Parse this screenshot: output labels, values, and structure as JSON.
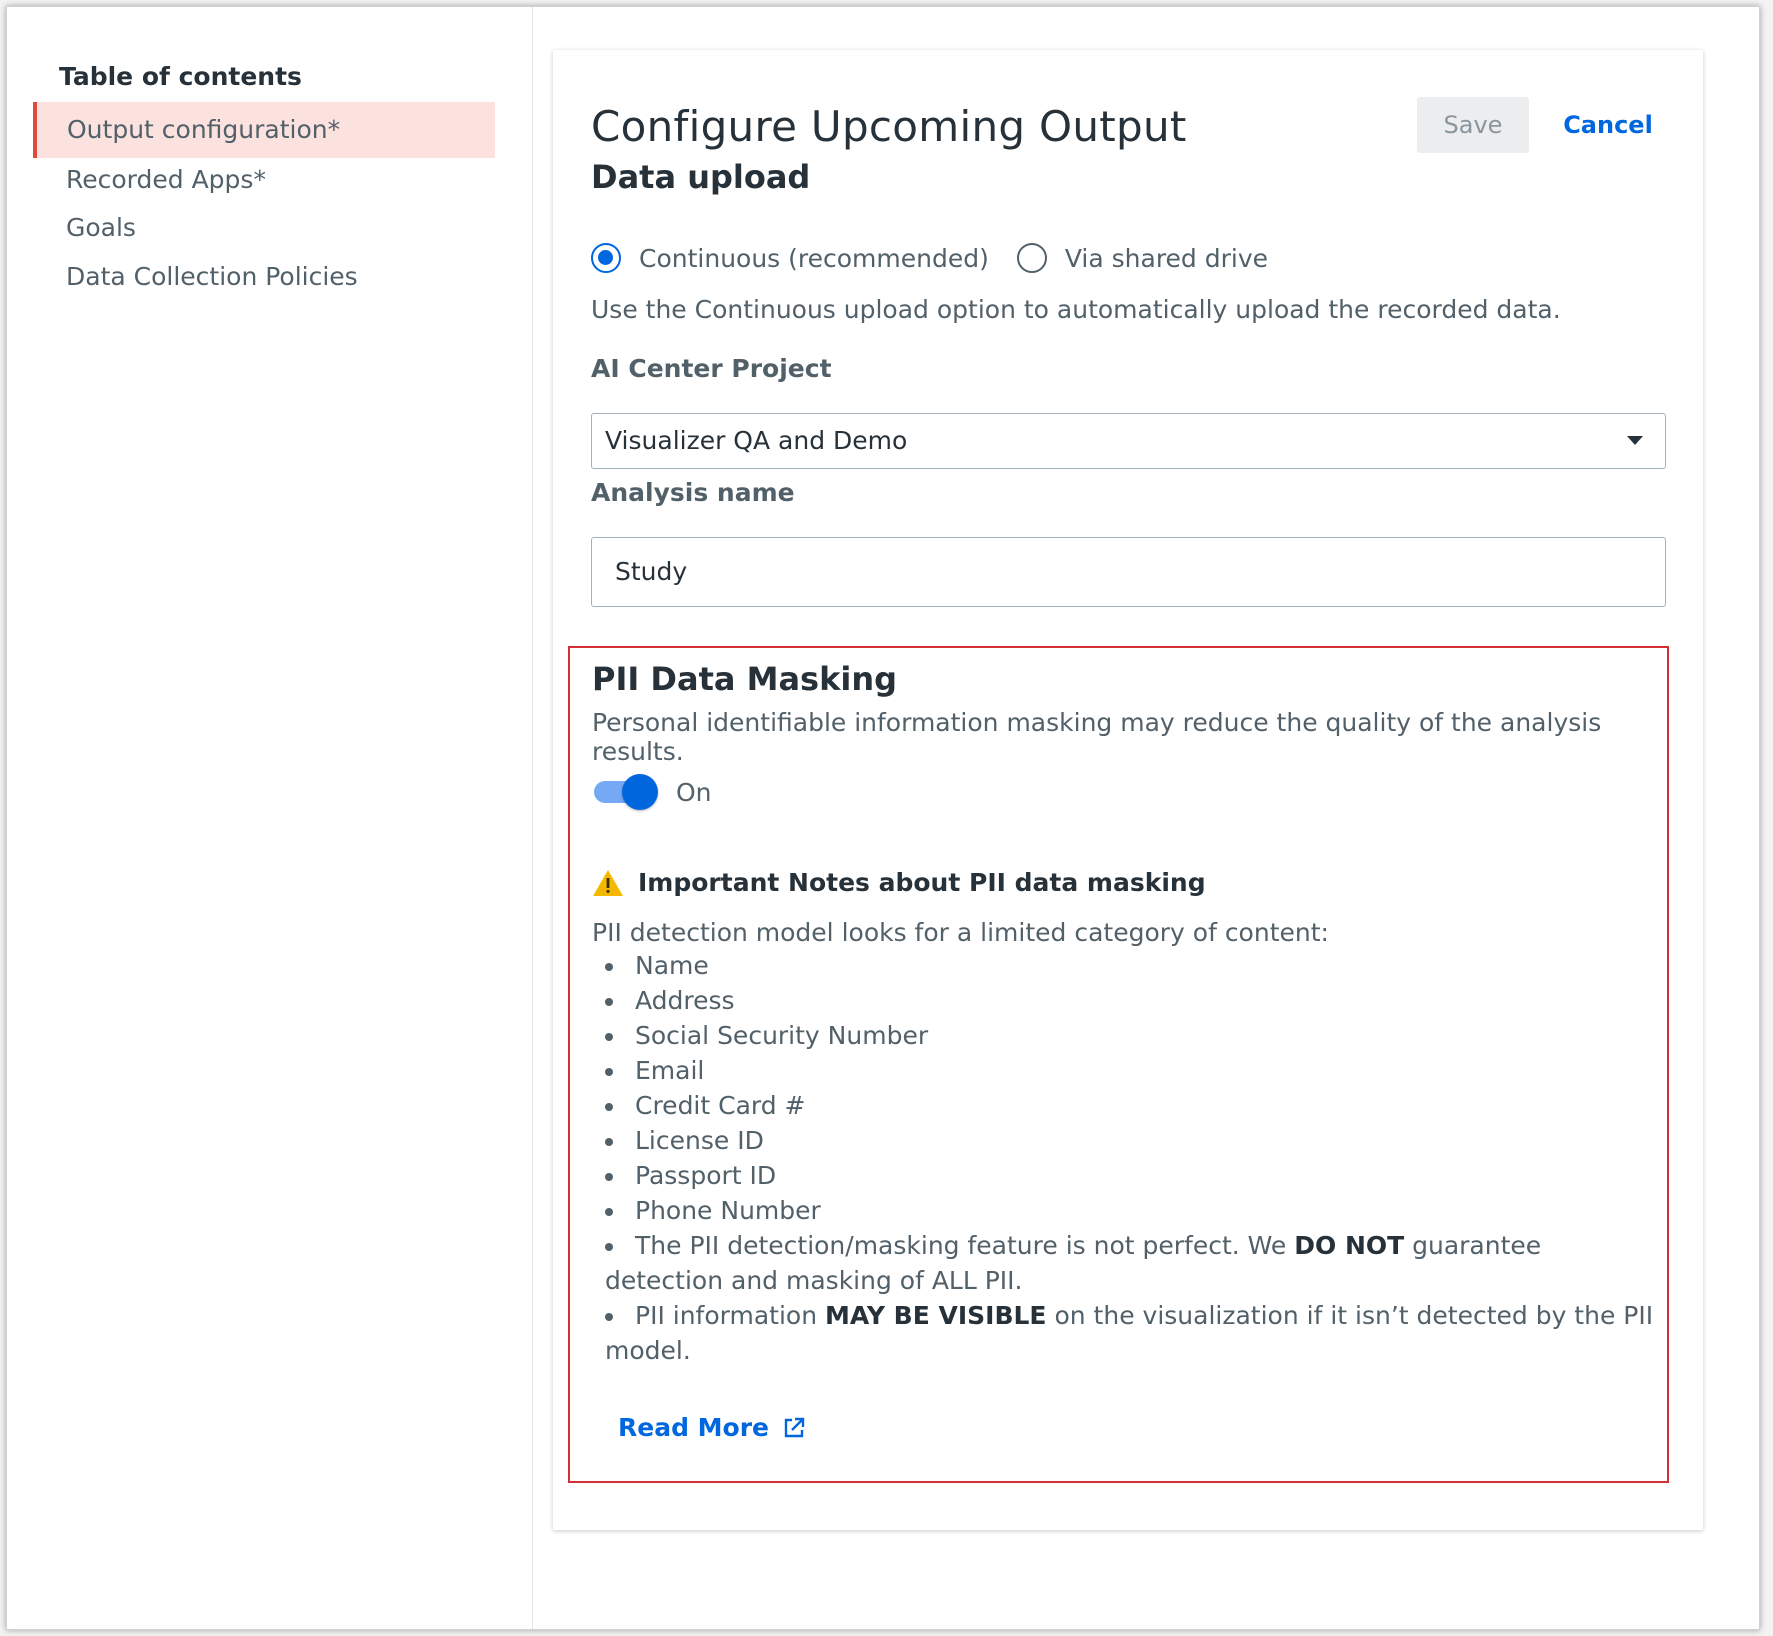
{
  "sidebar": {
    "title": "Table of contents",
    "items": [
      {
        "label": "Output configuration*",
        "active": true
      },
      {
        "label": "Recorded Apps*",
        "active": false
      },
      {
        "label": "Goals",
        "active": false
      },
      {
        "label": "Data Collection Policies",
        "active": false
      }
    ]
  },
  "header": {
    "title": "Configure Upcoming Output",
    "save_label": "Save",
    "cancel_label": "Cancel"
  },
  "data_upload": {
    "heading": "Data upload",
    "options": [
      {
        "label": "Continuous (recommended)",
        "selected": true
      },
      {
        "label": "Via shared drive",
        "selected": false
      }
    ],
    "help": "Use the Continuous upload option to automatically upload the recorded data."
  },
  "project": {
    "label": "AI Center Project",
    "value": "Visualizer QA and Demo"
  },
  "analysis": {
    "label": "Analysis name",
    "value": "Study"
  },
  "pii": {
    "title": "PII Data Masking",
    "description": "Personal identifiable information masking may reduce the quality of the analysis results.",
    "toggle_on": true,
    "toggle_label": "On",
    "notes_title": "Important Notes about PII data masking",
    "intro": "PII detection model looks for a limited category of content:",
    "categories": [
      "Name",
      "Address",
      "Social Security Number",
      "Email",
      "Credit Card #",
      "License ID",
      "Passport ID",
      "Phone Number"
    ],
    "note1": {
      "pre": "The PII detection/masking feature is not perfect. We ",
      "bold": "DO NOT",
      "post": " guarantee detection and masking of ALL PII."
    },
    "note2": {
      "pre": "PII information ",
      "bold": "MAY BE VISIBLE",
      "post": " on the visualization if it isn’t detected by the PII model."
    },
    "read_more": "Read More"
  },
  "colors": {
    "accent": "#0067df",
    "highlight_border": "#d62e36",
    "active_nav_bg": "#fbe2df",
    "warning": "#f5b800"
  },
  "icons": [
    "warning-icon",
    "external-link-icon",
    "chevron-down-icon"
  ]
}
